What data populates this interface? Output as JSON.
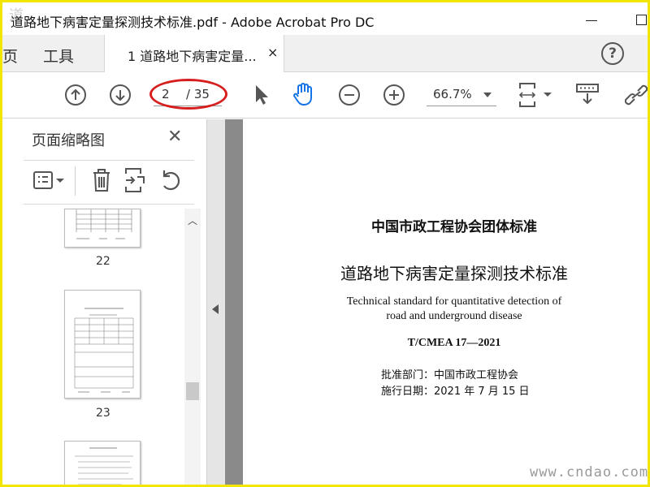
{
  "titlebar": {
    "watermark": "道",
    "title": "道路地下病害定量探测技术标准.pdf - Adobe Acrobat Pro DC"
  },
  "tabs": {
    "home": "页",
    "tools": "工具",
    "doc": "1 道路地下病害定量...",
    "close": "×",
    "help": "?"
  },
  "toolbar": {
    "page_current": "2",
    "page_total": "/ 35",
    "zoom": "66.7%"
  },
  "panel": {
    "title": "页面缩略图",
    "close": "✕",
    "pages": [
      "22",
      "23"
    ]
  },
  "document": {
    "org_title": "中国市政工程协会团体标准",
    "main_title": "道路地下病害定量探测技术标准",
    "en_line1": "Technical standard for quantitative detection of",
    "en_line2": "road and underground disease",
    "code": "T/CMEA  17—2021",
    "approver": "批准部门：中国市政工程协会",
    "date": "施行日期：2021 年 7 月 15 日"
  },
  "footer_watermark": "www.cndao.com",
  "colors": {
    "frame": "#f2e600",
    "ring": "#d61e1e",
    "hand_active": "#1473e6"
  }
}
